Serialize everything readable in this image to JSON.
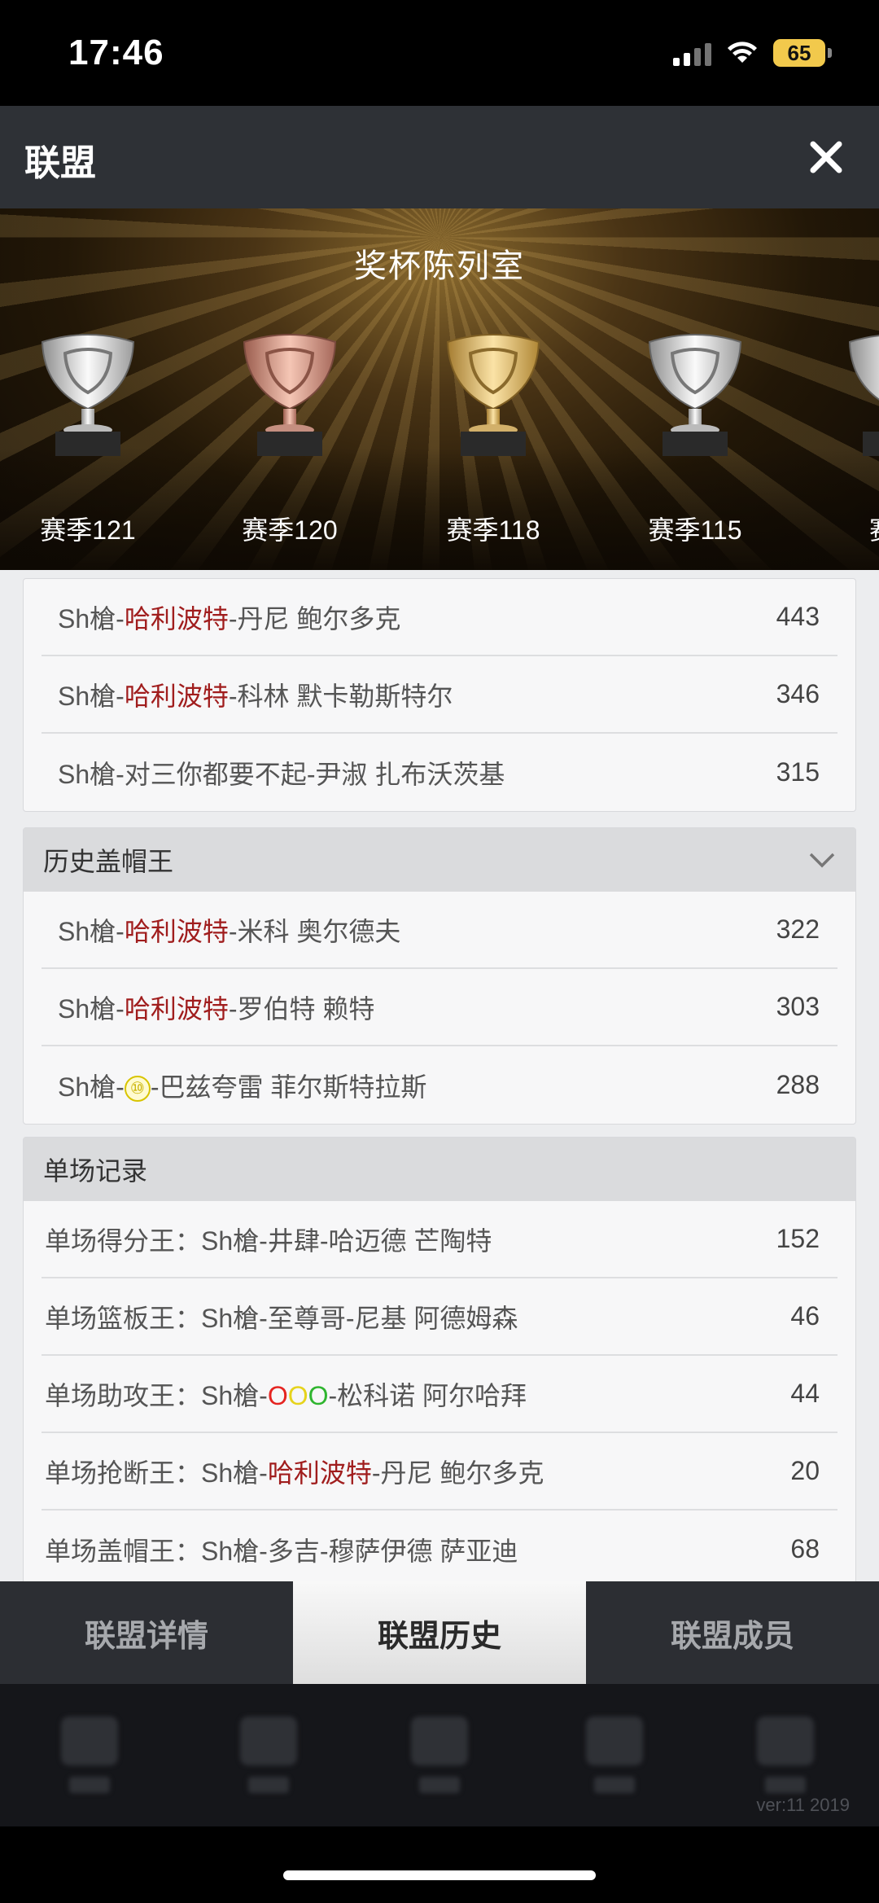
{
  "status_bar": {
    "time": "17:46",
    "battery": "65"
  },
  "header": {
    "title": "联盟"
  },
  "banner": {
    "title": "奖杯陈列室",
    "trophies": [
      {
        "label": "赛季121",
        "tone": "silver"
      },
      {
        "label": "赛季120",
        "tone": "bronze"
      },
      {
        "label": "赛季118",
        "tone": "gold"
      },
      {
        "label": "赛季115",
        "tone": "silver"
      },
      {
        "label": "赛季",
        "tone": "silver"
      }
    ]
  },
  "top_list": {
    "rows": [
      {
        "prefix": "Sh槍-",
        "team": "哈利波特",
        "player": "-丹尼 鲍尔多克",
        "value": "443"
      },
      {
        "prefix": "Sh槍-",
        "team": "哈利波特",
        "player": "-科林 默卡勒斯特尔",
        "value": "346"
      },
      {
        "prefix": "Sh槍-对三你都要不起",
        "team": "",
        "player": "-尹淑 扎布沃茨基",
        "value": "315"
      }
    ]
  },
  "blocks": {
    "title": "历史盖帽王",
    "rows": [
      {
        "prefix": "Sh槍-",
        "team": "哈利波特",
        "player": "-米科 奥尔德夫",
        "value": "322"
      },
      {
        "prefix": "Sh槍-",
        "team": "哈利波特",
        "player": "-罗伯特 赖特",
        "value": "303"
      },
      {
        "prefix": "Sh槍-",
        "badge": "⑩",
        "player": "-巴兹夸雷 菲尔斯特拉斯",
        "value": "288"
      }
    ]
  },
  "single_game": {
    "title": "单场记录",
    "rows": [
      {
        "label": "单场得分王：",
        "prefix": "Sh槍-井肆",
        "player": "-哈迈德 芒陶特",
        "value": "152"
      },
      {
        "label": "单场篮板王：",
        "prefix": "Sh槍-至尊哥",
        "player": "-尼基 阿德姆森",
        "value": "46"
      },
      {
        "label": "单场助攻王：",
        "prefix": "Sh槍-",
        "o1": "O",
        "o2": "O",
        "o3": "O",
        "player": "-松科诺 阿尔哈拜",
        "value": "44"
      },
      {
        "label": "单场抢断王：",
        "prefix": "Sh槍-",
        "team": "哈利波特",
        "player": "-丹尼 鲍尔多克",
        "value": "20"
      },
      {
        "label": "单场盖帽王：",
        "prefix": "Sh槍-多吉",
        "player": "-穆萨伊德 萨亚迪",
        "value": "68"
      }
    ]
  },
  "tabs": [
    {
      "label": "联盟详情"
    },
    {
      "label": "联盟历史"
    },
    {
      "label": "联盟成员"
    }
  ],
  "version": "ver:11  2019",
  "colors": {
    "team_red": "#a01d1d",
    "header_bg": "#2e3136",
    "tab_bg": "#2c2e33"
  }
}
